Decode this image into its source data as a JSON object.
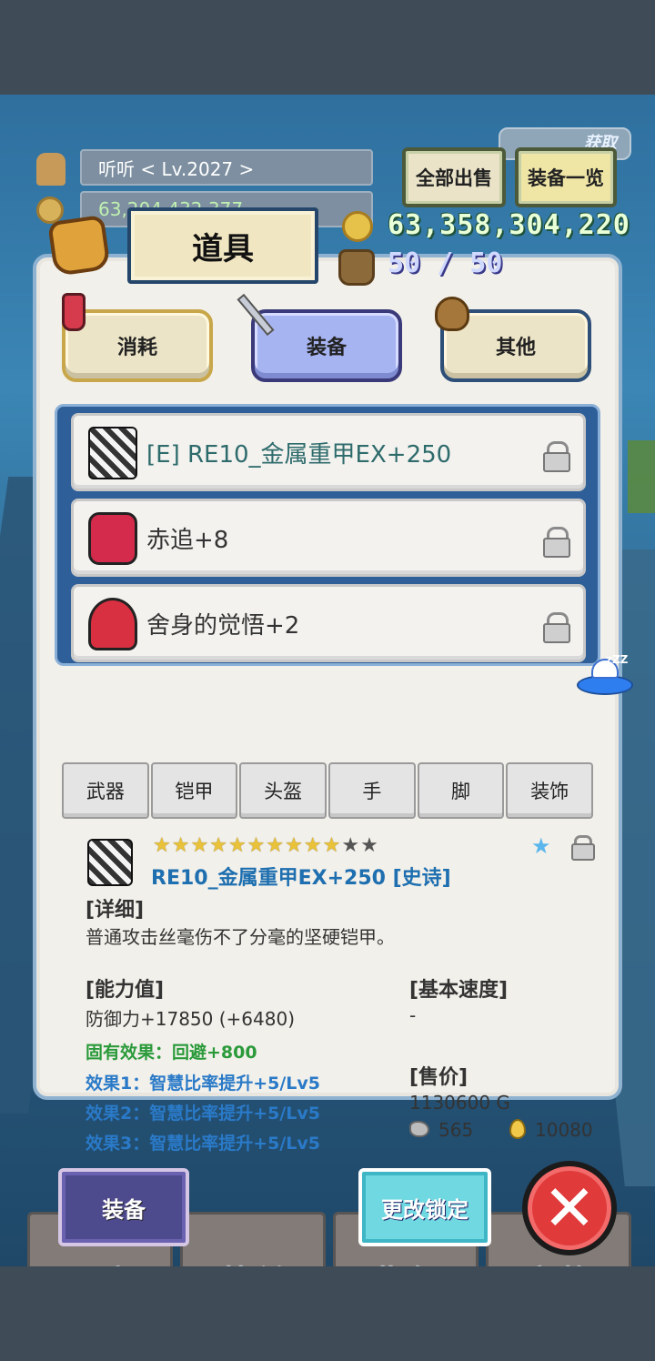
{
  "header": {
    "player_name_level": "听听    < Lv.2027 >",
    "player_gold_partial": "63,204,432,377",
    "get_badge": "获取",
    "sell_all": "全部出售",
    "equip_list": "装备一览"
  },
  "resources": {
    "gold": "63,358,304,220",
    "capacity": "50 / 50"
  },
  "panel": {
    "title": "道具",
    "categories": [
      {
        "label": "消耗"
      },
      {
        "label": "装备"
      },
      {
        "label": "其他"
      }
    ],
    "active_category": "装备",
    "items": [
      {
        "name": "[E] RE10_金属重甲EX+250",
        "equipped": true,
        "icon": "heavy-armor-icon"
      },
      {
        "name": "赤追+8",
        "equipped": false,
        "icon": "red-armor-icon"
      },
      {
        "name": "舍身的觉悟+2",
        "equipped": false,
        "icon": "red-helmet-icon"
      }
    ],
    "subtabs": [
      "武器",
      "铠甲",
      "头盔",
      "手",
      "脚",
      "装饰"
    ]
  },
  "detail": {
    "stars_filled": 10,
    "stars_total": 12,
    "name": "RE10_金属重甲EX+250 [史诗]",
    "detail_header": "[详细]",
    "description": "普通攻击丝毫伤不了分毫的坚硬铠甲。",
    "stats_header": "[能力值]",
    "defense": "防御力+17850 (+6480)",
    "inherent": "固有效果：回避+800",
    "effects": [
      "效果1：智慧比率提升+5/Lv5",
      "效果2：智慧比率提升+5/Lv5",
      "效果3：智慧比率提升+5/Lv5"
    ],
    "speed_header": "[基本速度]",
    "speed_value": "-",
    "price_header": "[售价]",
    "price_value": "1130600 G",
    "ore_value": "565",
    "drop_value": "10080"
  },
  "actions": {
    "equip": "装备",
    "change_lock": "更改锁定",
    "close_symbol": "✕"
  },
  "bottom_nav": [
    "工房",
    "菜单",
    "背包",
    "宠物"
  ],
  "colors": {
    "active_tab": "#a7b4f2",
    "equipped_item_text": "#2e6b6b",
    "epic_name": "#1e6fb0",
    "inherent_effect": "#2a9a3a",
    "effect_text": "#2a7ac8",
    "gold_text": "#e8ffd8",
    "close_button": "#e03a3a"
  }
}
